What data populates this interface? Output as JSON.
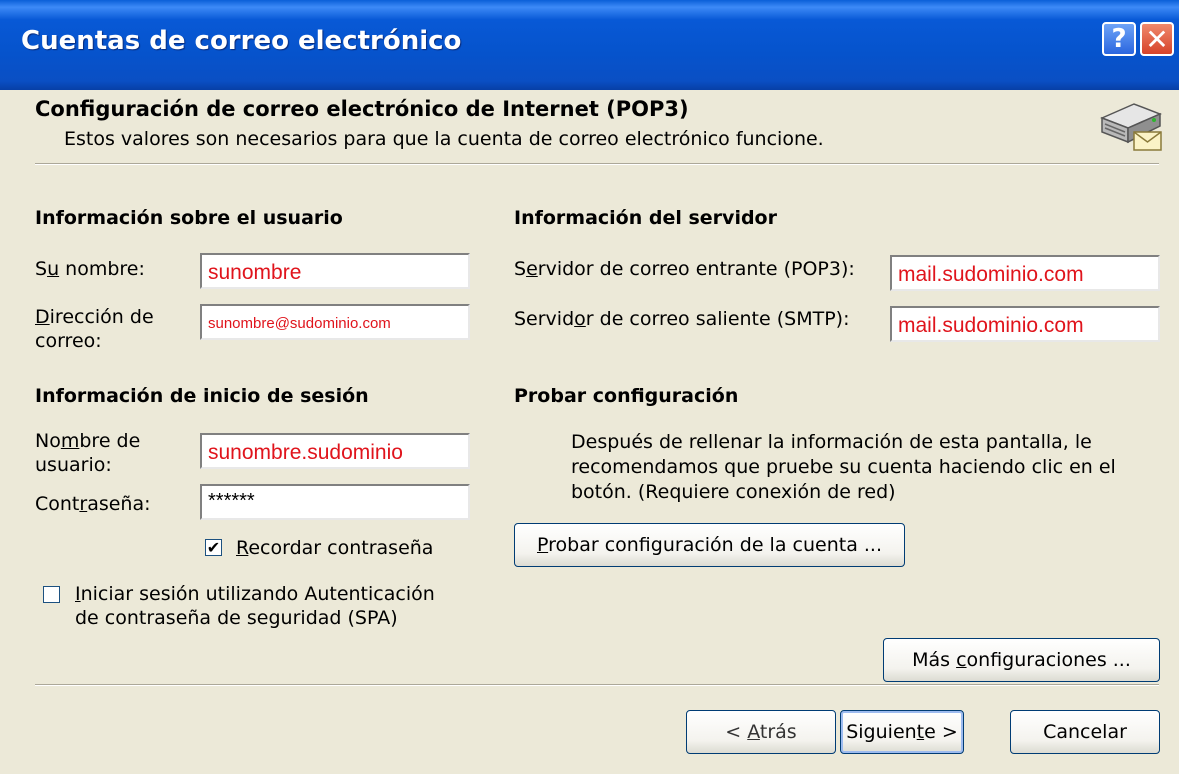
{
  "window": {
    "title": "Cuentas de correo electrónico",
    "help_glyph": "?",
    "close_glyph": "✕"
  },
  "header": {
    "title": "Configuración de correo electrónico de Internet (POP3)",
    "subtitle": "Estos valores son necesarios para que la cuenta de correo electrónico funcione.",
    "icon": "mail-server-icon"
  },
  "user_info": {
    "heading": "Información sobre el usuario",
    "name_label_pre": "S",
    "name_label_acc": "u",
    "name_label_post": " nombre:",
    "name_value": "sunombre",
    "email_label_acc": "D",
    "email_label_post": "irección de",
    "email_label_line2": "correo:",
    "email_value": "sunombre@sudominio.com"
  },
  "server_info": {
    "heading": "Información del servidor",
    "incoming_label_pre": "S",
    "incoming_label_acc": "e",
    "incoming_label_post": "rvidor de correo entrante (POP3):",
    "incoming_value": "mail.sudominio.com",
    "outgoing_label_pre": "Servid",
    "outgoing_label_acc": "o",
    "outgoing_label_post": "r de correo saliente (SMTP):",
    "outgoing_value": "mail.sudominio.com"
  },
  "logon_info": {
    "heading": "Información de inicio de sesión",
    "username_label_pre": "No",
    "username_label_acc": "m",
    "username_label_post": "bre de",
    "username_label_line2": "usuario:",
    "username_value": "sunombre.sudominio",
    "password_label_pre": "Cont",
    "password_label_acc": "r",
    "password_label_post": "aseña:",
    "password_value": "******",
    "remember_checked": true,
    "remember_acc": "R",
    "remember_post": "ecordar contraseña",
    "spa_checked": false,
    "spa_acc": "I",
    "spa_post": "niciar sesión utilizando Autenticación",
    "spa_line2": "de contraseña de seguridad (SPA)"
  },
  "test": {
    "heading": "Probar configuración",
    "description_line1": "Después de rellenar la información de esta pantalla, le",
    "description_line2": "recomendamos que pruebe su cuenta haciendo clic en el",
    "description_line3": "botón. (Requiere conexión de red)",
    "button_acc": "P",
    "button_post": "robar configuración de la cuenta ..."
  },
  "more_settings": {
    "pre": "Más ",
    "acc": "c",
    "post": "onfiguraciones ..."
  },
  "footer": {
    "back_pre": "< ",
    "back_acc": "A",
    "back_post": "trás",
    "next_pre": "Siguien",
    "next_acc": "t",
    "next_post": "e >",
    "cancel": "Cancelar"
  },
  "colors": {
    "titlebar": "#0653cc",
    "dialog_bg": "#ece9d8",
    "input_text": "#e0141c"
  }
}
